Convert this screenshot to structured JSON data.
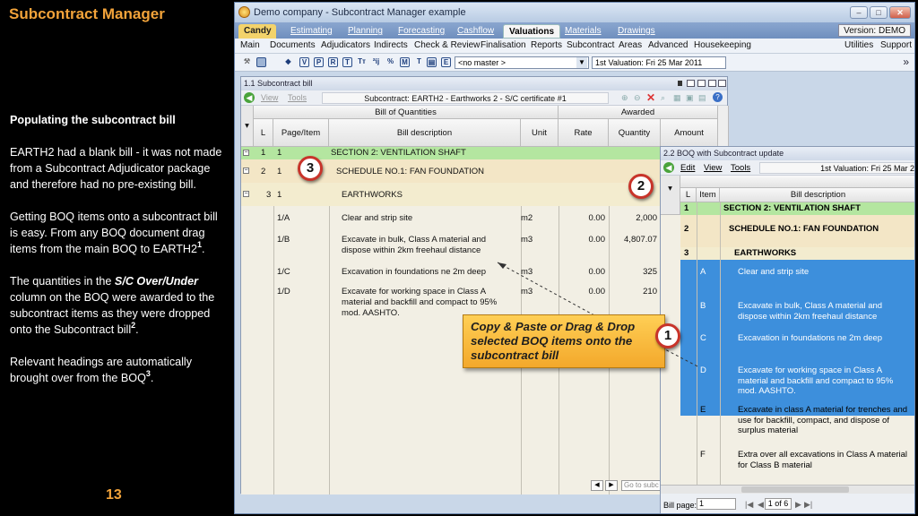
{
  "slide": {
    "title": "Subcontract Manager",
    "heading": "Populating the subcontract bill",
    "p1": "EARTH2 had a blank bill - it was not made from a Subcontract Adjudicator package and therefore had no pre-existing bill.",
    "p2": "Getting BOQ items onto a subcontract bill is easy.  From any BOQ document drag items from the main BOQ to EARTH2",
    "p2_sup": "1",
    "p2_end": ".",
    "p3_a": "The quantities in the ",
    "p3_em": "S/C Over/Under",
    "p3_b": " column on the BOQ were awarded to the subcontract items as they were dropped onto the Subcontract bill",
    "p3_sup": "2",
    "p3_end": ".",
    "p4": "Relevant headings are automatically brought over from the BOQ",
    "p4_sup": "3",
    "p4_end": ".",
    "page_number": "13"
  },
  "app": {
    "title": "Demo company - Subcontract Manager example",
    "tabs": [
      "Candy",
      "Estimating",
      "Planning",
      "Forecasting",
      "Cashflow",
      "Valuations",
      "Materials",
      "Drawings"
    ],
    "version": "Version: DEMO",
    "menus": [
      "Main",
      "Documents",
      "Adjudicators",
      "Indirects",
      "Check & Review",
      "Finalisation",
      "Reports",
      "Subcontract",
      "Areas",
      "Advanced",
      "Housekeeping"
    ],
    "menus_right": [
      "Utilities",
      "Support"
    ],
    "master_select": "<no master >",
    "valuation_select": "1st Valuation: Fri 25 Mar 2011",
    "toolbar_icons": [
      "V",
      "P",
      "R",
      "T",
      "Tт",
      "ªij",
      "%",
      "M",
      "E"
    ]
  },
  "bill": {
    "window_title": "1.1 Subcontract bill",
    "menu_view": "View",
    "menu_tools": "Tools",
    "subtitle": "Subcontract: EARTH2 - Earthworks 2 - S/C certificate #1",
    "group_boq": "Bill of Quantities",
    "group_awarded": "Awarded",
    "col_l": "L",
    "col_page": "Page/Item",
    "col_desc": "Bill description",
    "col_unit": "Unit",
    "col_rate": "Rate",
    "col_qty": "Quantity",
    "col_amount": "Amount",
    "rows": [
      {
        "l": "1",
        "page": "1",
        "desc": "SECTION 2: VENTILATION SHAFT",
        "unit": "",
        "rate": "",
        "qty": ""
      },
      {
        "l": "2",
        "page": "1",
        "desc": "SCHEDULE NO.1: FAN FOUNDATION",
        "unit": "",
        "rate": "",
        "qty": ""
      },
      {
        "l": "3",
        "page": "1",
        "desc": "EARTHWORKS",
        "unit": "",
        "rate": "",
        "qty": ""
      },
      {
        "l": "",
        "page": "1/A",
        "desc": "Clear and strip site",
        "unit": "m2",
        "rate": "0.00",
        "qty": "2,000"
      },
      {
        "l": "",
        "page": "1/B",
        "desc": "Excavate in bulk, Class A material and dispose within 2km freehaul distance",
        "unit": "m3",
        "rate": "0.00",
        "qty": "4,807.07"
      },
      {
        "l": "",
        "page": "1/C",
        "desc": "Excavation in foundations ne 2m deep",
        "unit": "m3",
        "rate": "0.00",
        "qty": "325"
      },
      {
        "l": "",
        "page": "1/D",
        "desc": "Excavate for working space in Class A material and backfill and compact to 95% mod. AASHTO.",
        "unit": "m3",
        "rate": "0.00",
        "qty": "210"
      }
    ],
    "goto": "Go to subc"
  },
  "boq": {
    "window_title": "2.2 BOQ with Subcontract update",
    "menu_edit": "Edit",
    "menu_view": "View",
    "menu_tools": "Tools",
    "valuation": "1st Valuation: Fri 25 Mar 2",
    "col_l": "L",
    "col_item": "Item",
    "col_desc": "Bill description",
    "rows": [
      {
        "l": "1",
        "item": "",
        "desc": "SECTION 2: VENTILATION SHAFT"
      },
      {
        "l": "2",
        "item": "",
        "desc": "SCHEDULE NO.1: FAN FOUNDATION"
      },
      {
        "l": "3",
        "item": "",
        "desc": "EARTHWORKS"
      },
      {
        "l": "",
        "item": "A",
        "desc": "Clear and strip site"
      },
      {
        "l": "",
        "item": "B",
        "desc": "Excavate in bulk, Class A material and dispose within 2km freehaul distance"
      },
      {
        "l": "",
        "item": "C",
        "desc": "Excavation in foundations ne 2m deep"
      },
      {
        "l": "",
        "item": "D",
        "desc": "Excavate for working space in Class A material and backfill and compact to 95% mod. AASHTO."
      },
      {
        "l": "",
        "item": "E",
        "desc": "Excavate in class A material for trenches and use for backfill, compact, and dispose of surplus material"
      },
      {
        "l": "",
        "item": "F",
        "desc": "Extra over all excavations in Class A material for Class B material"
      }
    ],
    "bill_page_label": "Bill page:",
    "bill_page_value": "1",
    "pager": "1 of 6"
  },
  "callouts": {
    "badge1": "1",
    "badge2": "2",
    "badge3": "3",
    "text": "Copy & Paste or Drag & Drop selected BOQ items onto the subcontract bill"
  },
  "colors": {
    "accent_orange": "#f2a33a",
    "heading_green": "#b4e6a0",
    "selection_blue": "#3d8fdc",
    "callout_red": "#c8342a"
  }
}
